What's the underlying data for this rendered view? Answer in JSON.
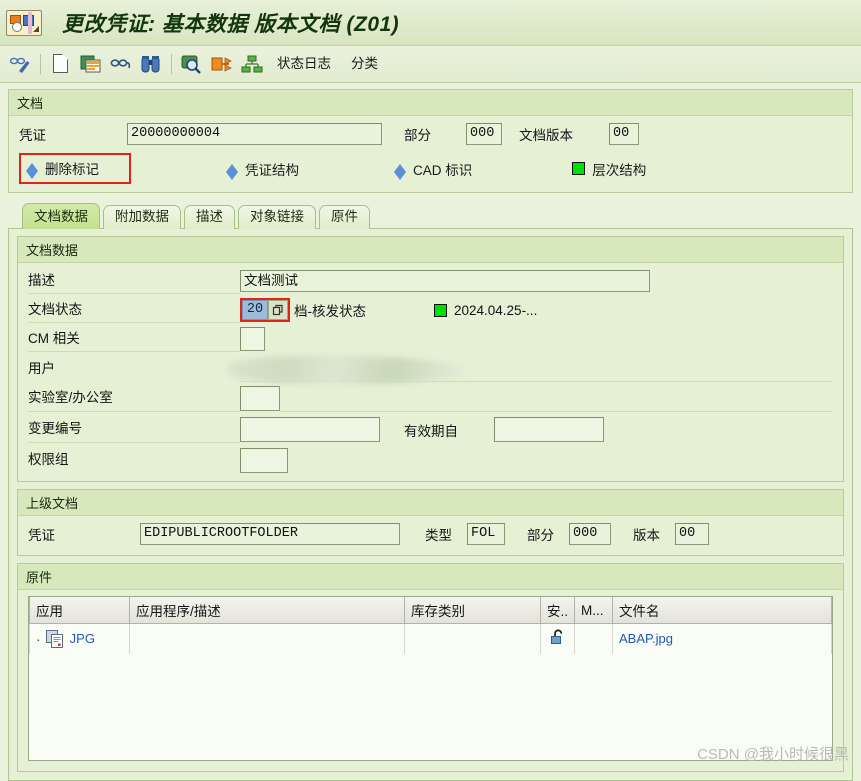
{
  "window": {
    "title": "更改凭证: 基本数据 版本文档 (Z01)",
    "app_icon": "sap-document-icon"
  },
  "toolbar": {
    "buttons": [
      {
        "name": "display-change-toggle",
        "icon": "glasses-pencil-icon",
        "label": ""
      },
      {
        "name": "new-document",
        "icon": "page-icon",
        "label": ""
      },
      {
        "name": "copy-document",
        "icon": "copy-window-icon",
        "label": ""
      },
      {
        "name": "display-original",
        "icon": "glasses-icon",
        "label": ""
      },
      {
        "name": "find",
        "icon": "binoculars-icon",
        "label": ""
      },
      {
        "name": "display-document-info",
        "icon": "magnifier-screen-icon",
        "label": ""
      },
      {
        "name": "send-document",
        "icon": "export-arrow-icon",
        "label": ""
      },
      {
        "name": "document-hierarchy",
        "icon": "hierarchy-icon",
        "label": ""
      }
    ],
    "text_buttons": [
      {
        "name": "status-log-button",
        "label": "状态日志"
      },
      {
        "name": "classification-button",
        "label": "分类"
      }
    ]
  },
  "document_section": {
    "header": "文档",
    "fields": {
      "voucher_label": "凭证",
      "voucher_value": "20000000004",
      "part_label": "部分",
      "part_value": "000",
      "version_label": "文档版本",
      "version_value": "00"
    },
    "action_buttons": [
      {
        "name": "delete-flag-button",
        "label": "删除标记",
        "icon": "blue-diamond-icon",
        "highlighted": true
      },
      {
        "name": "document-structure-button",
        "label": "凭证结构",
        "icon": "blue-diamond-icon",
        "highlighted": false
      },
      {
        "name": "cad-indicator-button",
        "label": "CAD 标识",
        "icon": "blue-diamond-icon",
        "highlighted": false
      },
      {
        "name": "hierarchy-structure-button",
        "label": "层次结构",
        "icon": "green-square-icon",
        "highlighted": false
      }
    ]
  },
  "tabs": [
    {
      "name": "tab-document-data",
      "label": "文档数据",
      "active": true
    },
    {
      "name": "tab-additional-data",
      "label": "附加数据",
      "active": false
    },
    {
      "name": "tab-description",
      "label": "描述",
      "active": false
    },
    {
      "name": "tab-object-links",
      "label": "对象链接",
      "active": false
    },
    {
      "name": "tab-originals",
      "label": "原件",
      "active": false
    }
  ],
  "document_data": {
    "header": "文档数据",
    "description_label": "描述",
    "description_value": "文档测试",
    "status_label": "文档状态",
    "status_value": "20",
    "status_text": "档-核发状态",
    "status_date": "2024.04.25-...",
    "status_indicator_color": "#00e000",
    "cm_relevant_label": "CM 相关",
    "cm_relevant_value": "",
    "user_label": "用户",
    "user_value": "",
    "lab_office_label": "实验室/办公室",
    "lab_office_value": "",
    "change_number_label": "变更编号",
    "change_number_value": "",
    "valid_from_label": "有效期自",
    "valid_from_value": "",
    "auth_group_label": "权限组",
    "auth_group_value": ""
  },
  "parent_document": {
    "header": "上级文档",
    "voucher_label": "凭证",
    "voucher_value": "EDIPUBLICROOTFOLDER",
    "type_label": "类型",
    "type_value": "FOL",
    "part_label": "部分",
    "part_value": "000",
    "version_label": "版本",
    "version_value": "00"
  },
  "originals": {
    "header": "原件",
    "columns": [
      "应用",
      "应用程序/描述",
      "库存类别",
      "安..",
      "M...",
      "文件名"
    ],
    "rows": [
      {
        "app": "JPG",
        "app_icon": "jpg-document-icon",
        "app_description": "",
        "storage_category": "",
        "security": "unlocked-padlock-icon",
        "mode": "",
        "file_name": "ABAP.jpg"
      }
    ]
  },
  "watermark": "CSDN @我小时候很黑"
}
